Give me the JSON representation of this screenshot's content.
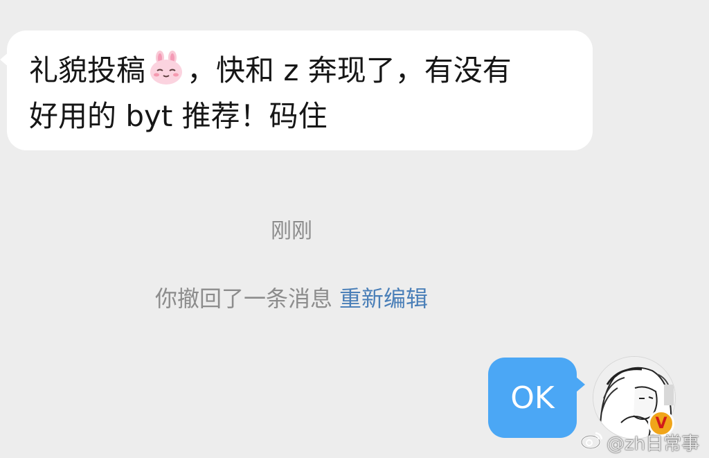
{
  "incoming_message": {
    "line1_before_emoji": "礼貌投稿",
    "emoji": "rabbit-face-emoji",
    "line1_after_emoji": "，快和 z 奔现了，有没有",
    "line2": "好用的 byt 推荐！码住"
  },
  "timestamp": "刚刚",
  "system_notice": {
    "recall_text": "你撤回了一条消息",
    "reedit_label": "重新编辑"
  },
  "outgoing_message": {
    "text": "OK"
  },
  "avatar": {
    "badge_text": "V"
  },
  "watermark": {
    "icon": "weibo-icon",
    "text": "@zh日常事"
  },
  "colors": {
    "background": "#ededed",
    "incoming_bubble": "#ffffff",
    "outgoing_bubble": "#4ba7f5",
    "link": "#4a7fb8",
    "muted_text": "#8c8c8c"
  }
}
